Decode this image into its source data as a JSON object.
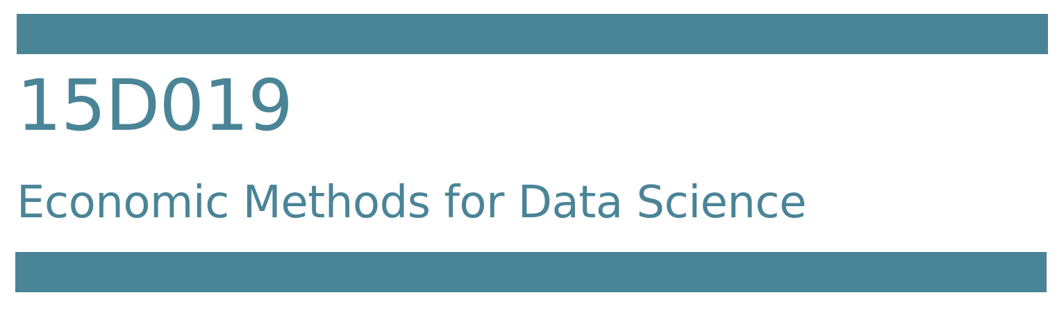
{
  "course": {
    "code": "15D019",
    "title": "Economic Methods for Data Science"
  },
  "colors": {
    "accent": "#4a8497",
    "background": "#ffffff"
  }
}
